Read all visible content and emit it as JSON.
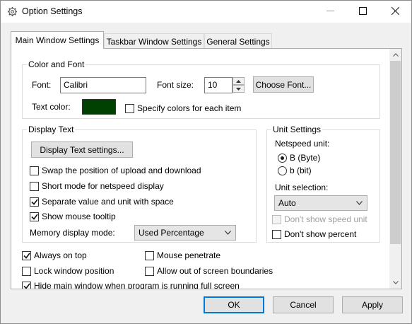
{
  "window": {
    "title": "Option Settings"
  },
  "tabs": [
    {
      "label": "Main Window Settings",
      "active": true
    },
    {
      "label": "Taskbar Window Settings",
      "active": false
    },
    {
      "label": "General Settings",
      "active": false
    }
  ],
  "color_font": {
    "group_title": "Color and Font",
    "font_label": "Font:",
    "font_value": "Calibri",
    "font_size_label": "Font size:",
    "font_size_value": "10",
    "choose_font_label": "Choose Font...",
    "text_color_label": "Text color:",
    "text_color_hex": "#004000",
    "specify_colors_label": "Specify colors for each item",
    "specify_colors_checked": false
  },
  "display_text": {
    "group_title": "Display Text",
    "settings_button_label": "Display Text settings...",
    "swap_label": "Swap the position of upload and download",
    "swap_checked": false,
    "short_mode_label": "Short mode for netspeed display",
    "short_mode_checked": false,
    "separate_label": "Separate value and unit with space",
    "separate_checked": true,
    "tooltip_label": "Show mouse tooltip",
    "tooltip_checked": true,
    "memory_label": "Memory display mode:",
    "memory_value": "Used Percentage"
  },
  "unit_settings": {
    "group_title": "Unit Settings",
    "netspeed_label": "Netspeed unit:",
    "byte_label": "B (Byte)",
    "byte_selected": true,
    "bit_label": "b (bit)",
    "bit_selected": false,
    "unit_selection_label": "Unit selection:",
    "unit_selection_value": "Auto",
    "dont_show_speed_label": "Don't show speed unit",
    "dont_show_speed_checked": false,
    "dont_show_speed_disabled": true,
    "dont_show_percent_label": "Don't show percent",
    "dont_show_percent_checked": false
  },
  "bottom_options": {
    "always_on_top_label": "Always on top",
    "always_on_top_checked": true,
    "mouse_penetrate_label": "Mouse penetrate",
    "mouse_penetrate_checked": false,
    "lock_position_label": "Lock window position",
    "lock_position_checked": false,
    "out_of_bounds_label": "Allow out of screen boundaries",
    "out_of_bounds_checked": false,
    "hide_fullscreen_label": "Hide main window when program is running full screen",
    "hide_fullscreen_checked": true
  },
  "buttons": {
    "ok_label": "OK",
    "cancel_label": "Cancel",
    "apply_label": "Apply"
  },
  "icons": {
    "title": "gear-icon",
    "minimize": "minimize-icon",
    "maximize": "maximize-icon",
    "close": "close-icon",
    "check": "check-icon",
    "dropdown": "chevron-down-icon",
    "scroll_up": "scroll-up-icon",
    "scroll_down": "scroll-down-icon"
  }
}
